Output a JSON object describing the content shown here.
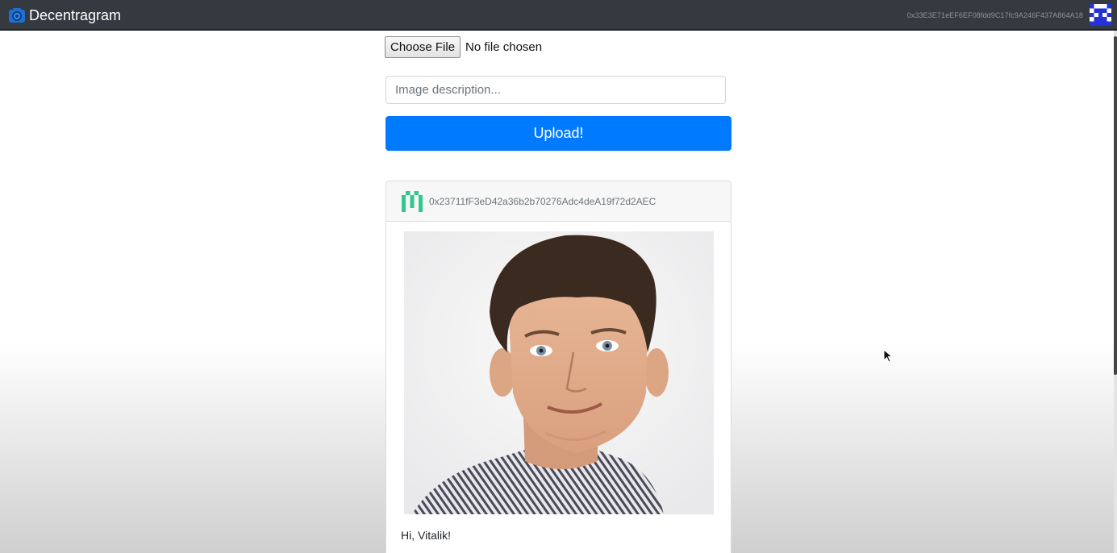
{
  "navbar": {
    "brand": "Decentragram",
    "brand_icon": "camera-icon",
    "account_address": "0x33E3E71eEF6EF08fdd9C17fc9A246F437A864A18",
    "account_avatar": "identicon-avatar"
  },
  "upload_form": {
    "choose_file_label": "Choose File",
    "file_status": "No file chosen",
    "description_placeholder": "Image description...",
    "description_value": "",
    "upload_label": "Upload!"
  },
  "post": {
    "author_address": "0x23711fF3eD42a36b2b70276Adc4deA19f72d2AEC",
    "author_avatar": "identicon-avatar",
    "image": "portrait-photo",
    "description": "Hi, Vitalik!"
  },
  "colors": {
    "navbar": "#343a40",
    "primary": "#007bff",
    "identicon_green": "#2fc98e",
    "identicon_blue": "#2433d8"
  }
}
